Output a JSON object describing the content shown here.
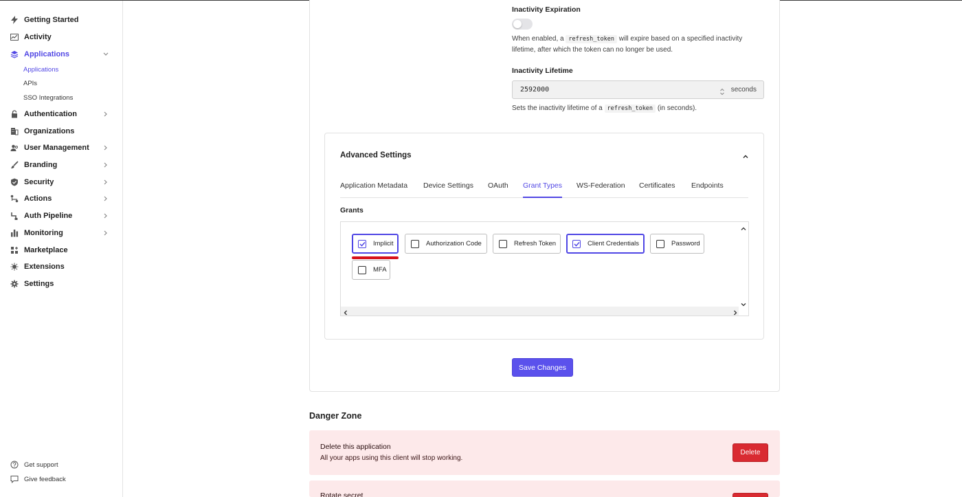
{
  "sidebar": {
    "items": [
      {
        "label": "Getting Started",
        "icon": "bolt-icon",
        "chevron": false
      },
      {
        "label": "Activity",
        "icon": "activity-chart-icon",
        "chevron": false
      },
      {
        "label": "Applications",
        "icon": "layers-icon",
        "chevron": "down",
        "active": true
      },
      {
        "label": "Authentication",
        "icon": "lock-icon",
        "chevron": "right"
      },
      {
        "label": "Organizations",
        "icon": "building-icon",
        "chevron": false
      },
      {
        "label": "User Management",
        "icon": "users-icon",
        "chevron": "right"
      },
      {
        "label": "Branding",
        "icon": "brush-icon",
        "chevron": "right"
      },
      {
        "label": "Security",
        "icon": "shield-icon",
        "chevron": "right"
      },
      {
        "label": "Actions",
        "icon": "actions-flow-icon",
        "chevron": "right"
      },
      {
        "label": "Auth Pipeline",
        "icon": "pipeline-icon",
        "chevron": "right"
      },
      {
        "label": "Monitoring",
        "icon": "bar-chart-icon",
        "chevron": "right"
      },
      {
        "label": "Marketplace",
        "icon": "grid-plus-icon",
        "chevron": false
      },
      {
        "label": "Extensions",
        "icon": "extension-icon",
        "chevron": false
      },
      {
        "label": "Settings",
        "icon": "gear-icon",
        "chevron": false
      }
    ],
    "sub_items": [
      "Applications",
      "APIs",
      "SSO Integrations"
    ],
    "footer": {
      "support": "Get support",
      "feedback": "Give feedback"
    }
  },
  "refresh": {
    "inactivity_expiration_label": "Inactivity Expiration",
    "inactivity_expiration_enabled": false,
    "help_1_pre": "When enabled, a",
    "help_1_code": "refresh_token",
    "help_1_post": "will expire based on a specified inactivity",
    "help_1_line2": "lifetime, after which the token can no longer be used.",
    "inactivity_lifetime_label": "Inactivity Lifetime",
    "inactivity_lifetime_value": "2592000",
    "inactivity_lifetime_unit": "seconds",
    "help_2_pre": "Sets the inactivity lifetime of a",
    "help_2_code": "refresh_token",
    "help_2_post": "(in seconds)."
  },
  "advanced": {
    "title": "Advanced Settings",
    "tabs": [
      "Application Metadata",
      "Device Settings",
      "OAuth",
      "Grant Types",
      "WS-Federation",
      "Certificates",
      "Endpoints"
    ],
    "active_tab": "Grant Types",
    "grants_label": "Grants",
    "grants": [
      {
        "label": "Implicit",
        "checked": true
      },
      {
        "label": "Authorization Code",
        "checked": false
      },
      {
        "label": "Refresh Token",
        "checked": false
      },
      {
        "label": "Client Credentials",
        "checked": true
      },
      {
        "label": "Password",
        "checked": false
      },
      {
        "label": "MFA",
        "checked": false
      }
    ]
  },
  "save_label": "Save Changes",
  "danger": {
    "title": "Danger Zone",
    "rows": [
      {
        "title": "Delete this application",
        "desc": "All your apps using this client will stop working.",
        "button": "Delete"
      },
      {
        "title": "Rotate secret"
      }
    ]
  },
  "colors": {
    "accent": "#5046e4",
    "danger": "#d92a31",
    "danger_bg": "#fde9ea",
    "highlight_underline": "#d7111b"
  }
}
